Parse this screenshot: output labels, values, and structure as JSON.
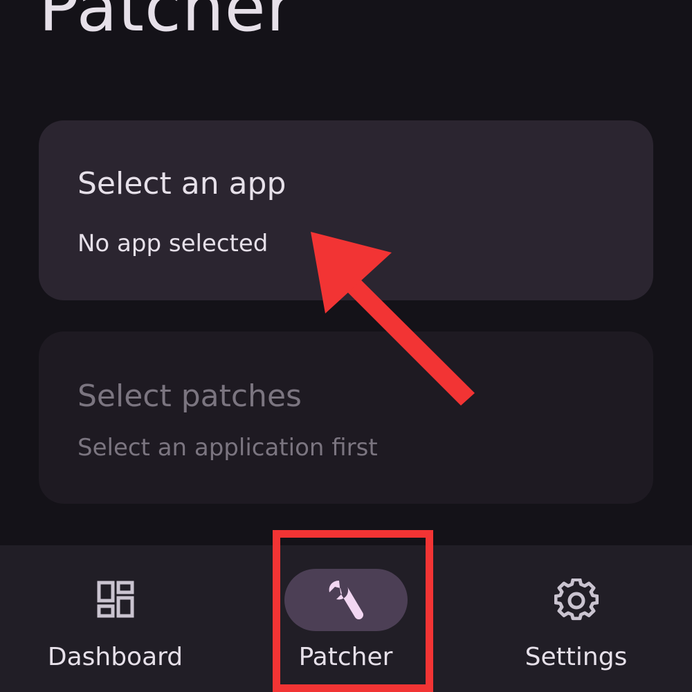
{
  "header": {
    "title": "Patcher"
  },
  "cards": {
    "app": {
      "title": "Select an app",
      "subtitle": "No app selected"
    },
    "patches": {
      "title": "Select patches",
      "subtitle": "Select an application first"
    }
  },
  "nav": {
    "items": [
      {
        "label": "Dashboard",
        "icon": "dashboard-icon",
        "selected": false
      },
      {
        "label": "Patcher",
        "icon": "wrench-icon",
        "selected": true
      },
      {
        "label": "Settings",
        "icon": "gear-icon",
        "selected": false
      }
    ]
  },
  "colors": {
    "background": "#141218",
    "card_active": "#2B2530",
    "card_disabled": "#1E1A22",
    "nav_background": "#211E26",
    "nav_indicator": "#4C3F55",
    "text_primary": "#E6E0E9",
    "text_disabled": "#7B7580",
    "icon_selected": "#F2D7F2",
    "annotation_red": "#F23434"
  }
}
